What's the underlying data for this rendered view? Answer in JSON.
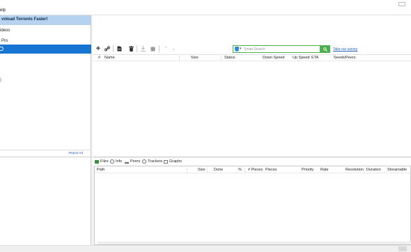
{
  "menu": {
    "help": "elp"
  },
  "sidebar": {
    "promo": "vnload Torrents Faster!",
    "items": [
      {
        "label": "ideos"
      },
      {
        "label": "Pro"
      },
      {
        "label": ""
      }
    ],
    "glyph": ")",
    "report_ad": "Report Ad"
  },
  "toolbar": {
    "icons": [
      "add-icon",
      "link-icon",
      "file-icon",
      "trash-icon",
      "download-icon",
      "stop-icon",
      "up-arrow-icon",
      "down-arrow-icon"
    ]
  },
  "search": {
    "placeholder": "Smart Search",
    "survey_link": "Take our survey"
  },
  "torrent_list": {
    "columns": [
      "#",
      "Name",
      "Size",
      "Status",
      "Down Speed",
      "Up Speed",
      "ETA",
      "Seeds/Peers"
    ]
  },
  "details": {
    "tabs": [
      "Files",
      "Info",
      "Peers",
      "Trackers",
      "Graphs"
    ],
    "columns": [
      "Path",
      "Size",
      "Done",
      "%",
      "# Pieces",
      "Pieces",
      "Priority",
      "Rate",
      "Resolution",
      "Duration",
      "Streamable"
    ]
  },
  "colors": {
    "accent": "#1874d2",
    "promo_bg": "#b7d2f0",
    "search_green": "#4caf50",
    "link": "#1a5fb4"
  }
}
